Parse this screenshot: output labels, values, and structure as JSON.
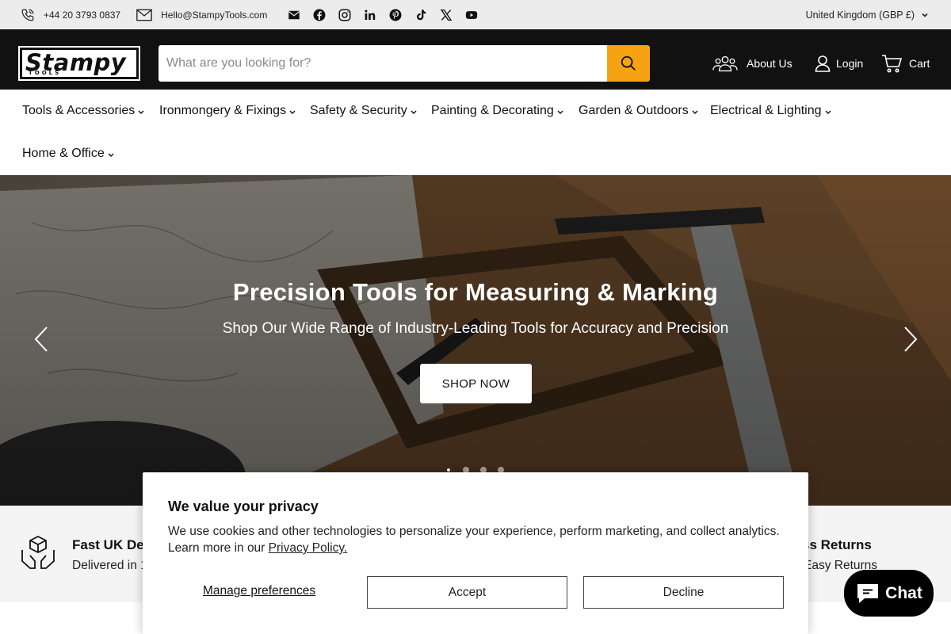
{
  "topbar": {
    "phone": "+44 20 3793 0837",
    "email": "Hello@StampyTools.com",
    "socials": [
      "mail-icon",
      "facebook-icon",
      "instagram-icon",
      "linkedin-icon",
      "pinterest-icon",
      "tiktok-icon",
      "x-icon",
      "youtube-icon"
    ],
    "region": "United Kingdom (GBP £)"
  },
  "header": {
    "logo_main": "Stampy",
    "logo_sub": "TOOLS",
    "search_placeholder": "What are you looking for?",
    "about_label": "About Us",
    "login_label": "Login",
    "cart_label": "Cart",
    "accent": "#f5a312"
  },
  "nav": {
    "items": [
      {
        "label": "Tools & Accessories"
      },
      {
        "label": "Ironmongery & Fixings"
      },
      {
        "label": "Safety & Security"
      },
      {
        "label": "Painting & Decorating"
      },
      {
        "label": "Garden & Outdoors"
      },
      {
        "label": "Electrical & Lighting"
      },
      {
        "label": "Home & Office"
      }
    ]
  },
  "hero": {
    "title": "Precision Tools for Measuring & Marking",
    "subtitle": "Shop Our Wide Range of Industry-Leading Tools for Accuracy and Precision",
    "button": "SHOP NOW",
    "slide_count": 4,
    "active_slide": 1
  },
  "features": {
    "left_title": "Fast UK De",
    "left_text": "Delivered in 1",
    "right_title": "ss Returns",
    "right_text": "Easy Returns"
  },
  "cookie": {
    "title": "We value your privacy",
    "body": "We use cookies and other technologies to personalize your experience, perform marketing, and collect analytics. Learn more in our ",
    "link": "Privacy Policy.",
    "manage": "Manage preferences",
    "accept": "Accept",
    "decline": "Decline"
  },
  "chat": {
    "label": "Chat"
  }
}
